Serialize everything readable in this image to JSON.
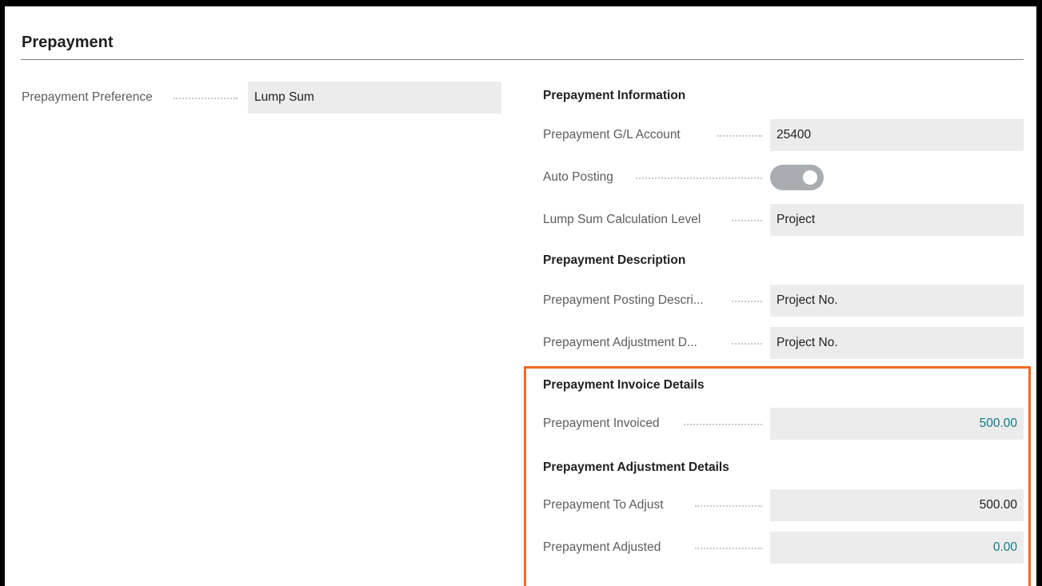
{
  "section": {
    "title": "Prepayment"
  },
  "left": {
    "prepayment_preference": {
      "label": "Prepayment Preference",
      "value": "Lump Sum"
    }
  },
  "prepayment_information": {
    "heading": "Prepayment Information",
    "gl_account": {
      "label": "Prepayment  G/L Account",
      "value": "25400"
    },
    "auto_posting": {
      "label": "Auto Posting",
      "enabled": true
    },
    "lump_sum_calc_level": {
      "label": "Lump Sum Calculation Level",
      "value": "Project"
    }
  },
  "prepayment_description": {
    "heading": "Prepayment Description",
    "posting_description": {
      "label": "Prepayment Posting Descri...",
      "value": "Project No."
    },
    "adjustment_description": {
      "label": "Prepayment Adjustment D...",
      "value": "Project No."
    }
  },
  "prepayment_invoice_details": {
    "heading": "Prepayment Invoice Details",
    "invoiced": {
      "label": "Prepayment Invoiced",
      "value": "500.00"
    }
  },
  "prepayment_adjustment_details": {
    "heading": "Prepayment Adjustment Details",
    "to_adjust": {
      "label": "Prepayment To Adjust",
      "value": "500.00"
    },
    "adjusted": {
      "label": "Prepayment Adjusted",
      "value": "0.00"
    }
  },
  "colors": {
    "highlight_border": "#f26b21",
    "link_value": "#0e7c86",
    "toggle_track": "#a9adb2"
  }
}
